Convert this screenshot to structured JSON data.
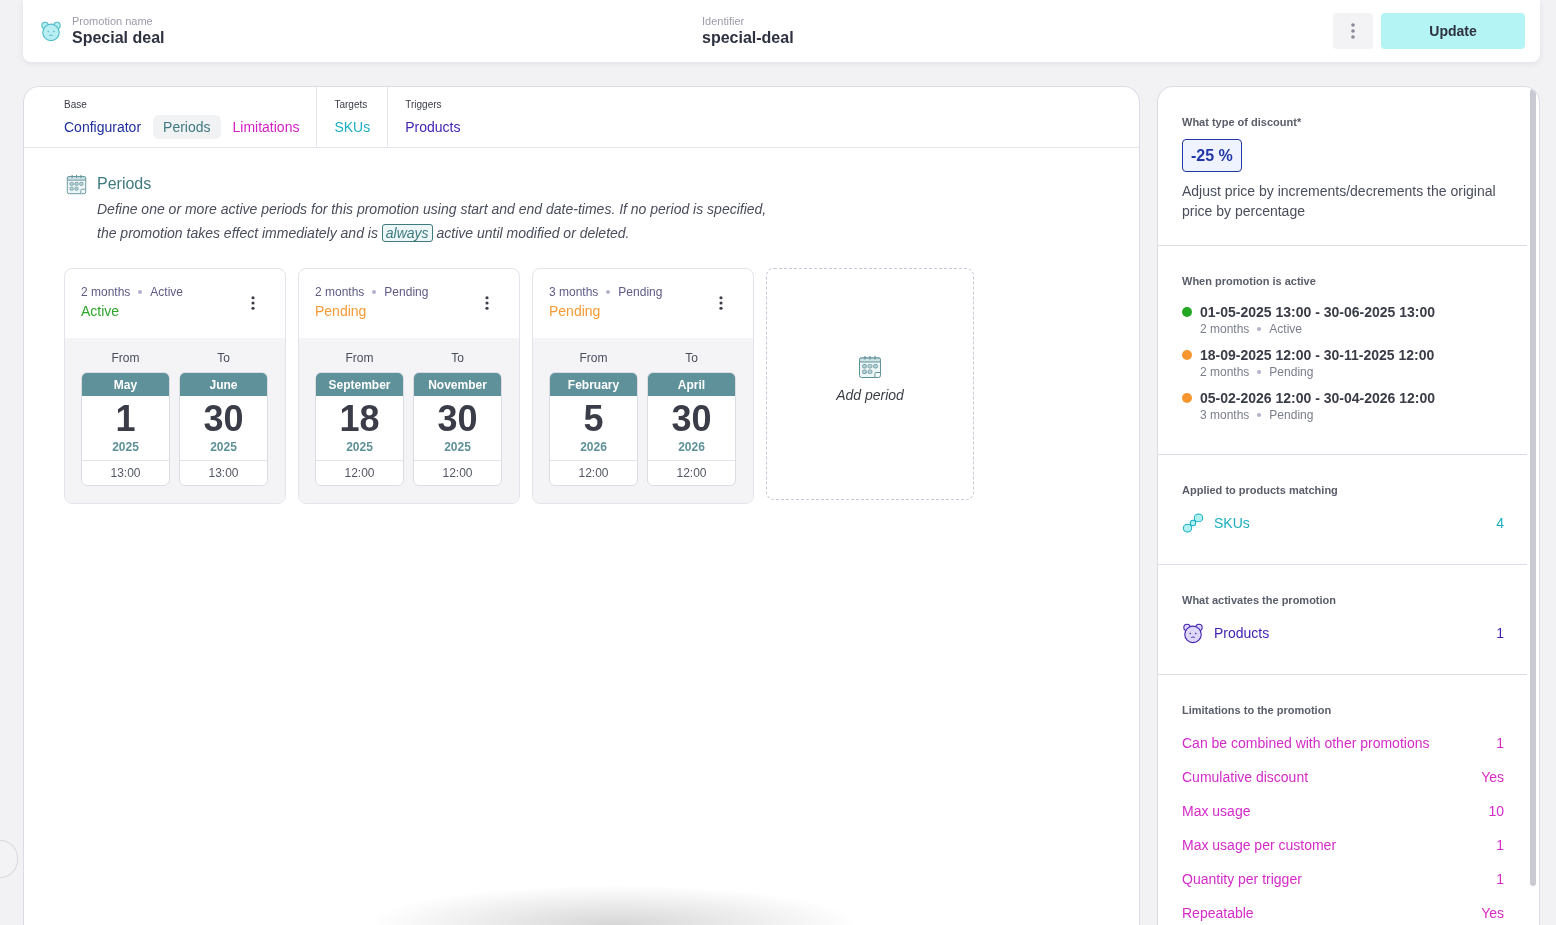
{
  "header": {
    "name_label": "Promotion name",
    "name": "Special deal",
    "identifier_label": "Identifier",
    "identifier": "special-deal",
    "update_button": "Update"
  },
  "tab_groups": [
    {
      "label": "Base",
      "tabs": [
        {
          "label": "Configurator",
          "selected": false,
          "color": "#1f2f9f"
        },
        {
          "label": "Periods",
          "selected": true,
          "color": "#3f7a80"
        },
        {
          "label": "Limitations",
          "selected": false,
          "color": "#d21fc4"
        }
      ]
    },
    {
      "label": "Targets",
      "tabs": [
        {
          "label": "SKUs",
          "selected": false,
          "color": "#1aaec0"
        }
      ]
    },
    {
      "label": "Triggers",
      "tabs": [
        {
          "label": "Products",
          "selected": false,
          "color": "#4423b3"
        }
      ]
    }
  ],
  "periods": {
    "title": "Periods",
    "description_before": "Define one or more active periods for this promotion using start and end date-times. If no period is specified, the promotion takes effect immediately and is",
    "highlight": "always",
    "description_after": "active until modified or deleted.",
    "add_label": "Add period",
    "cards": [
      {
        "duration": "2 months",
        "state": "Active",
        "status": "Active",
        "color": "#2ba52b",
        "from_label": "From",
        "to_label": "To",
        "from": {
          "month": "May",
          "day": "1",
          "year": "2025",
          "time": "13:00"
        },
        "to": {
          "month": "June",
          "day": "30",
          "year": "2025",
          "time": "13:00"
        }
      },
      {
        "duration": "2 months",
        "state": "Pending",
        "status": "Pending",
        "color": "#f79a33",
        "from_label": "From",
        "to_label": "To",
        "from": {
          "month": "September",
          "day": "18",
          "year": "2025",
          "time": "12:00"
        },
        "to": {
          "month": "November",
          "day": "30",
          "year": "2025",
          "time": "12:00"
        }
      },
      {
        "duration": "3 months",
        "state": "Pending",
        "status": "Pending",
        "color": "#f79a33",
        "from_label": "From",
        "to_label": "To",
        "from": {
          "month": "February",
          "day": "5",
          "year": "2026",
          "time": "12:00"
        },
        "to": {
          "month": "April",
          "day": "30",
          "year": "2026",
          "time": "12:00"
        }
      }
    ]
  },
  "summary": {
    "discount": {
      "label": "What type of discount*",
      "value": "-25 %",
      "description": "Adjust price by increments/decrements the original price by percentage"
    },
    "active": {
      "label": "When promotion is active",
      "items": [
        {
          "range": "01-05-2025 13:00 - 30-06-2025 13:00",
          "duration": "2 months",
          "state": "Active",
          "color": "#22a822"
        },
        {
          "range": "18-09-2025 12:00 - 30-11-2025 12:00",
          "duration": "2 months",
          "state": "Pending",
          "color": "#f7962f"
        },
        {
          "range": "05-02-2026 12:00 - 30-04-2026 12:00",
          "duration": "3 months",
          "state": "Pending",
          "color": "#f7962f"
        }
      ]
    },
    "targets": {
      "label": "Applied to products matching",
      "items": [
        {
          "kind": "sku",
          "label": "SKUs",
          "count": "4",
          "color": "#1aaec0"
        }
      ]
    },
    "triggers": {
      "label": "What activates the promotion",
      "items": [
        {
          "kind": "product",
          "label": "Products",
          "count": "1",
          "color": "#4423b3"
        }
      ]
    },
    "limitations": {
      "label": "Limitations to the promotion",
      "items": [
        {
          "label": "Can be combined with other promotions",
          "value": "1"
        },
        {
          "label": "Cumulative discount",
          "value": "Yes"
        },
        {
          "label": "Max usage",
          "value": "10"
        },
        {
          "label": "Max usage per customer",
          "value": "1"
        },
        {
          "label": "Quantity per trigger",
          "value": "1"
        },
        {
          "label": "Repeatable",
          "value": "Yes"
        }
      ]
    }
  }
}
